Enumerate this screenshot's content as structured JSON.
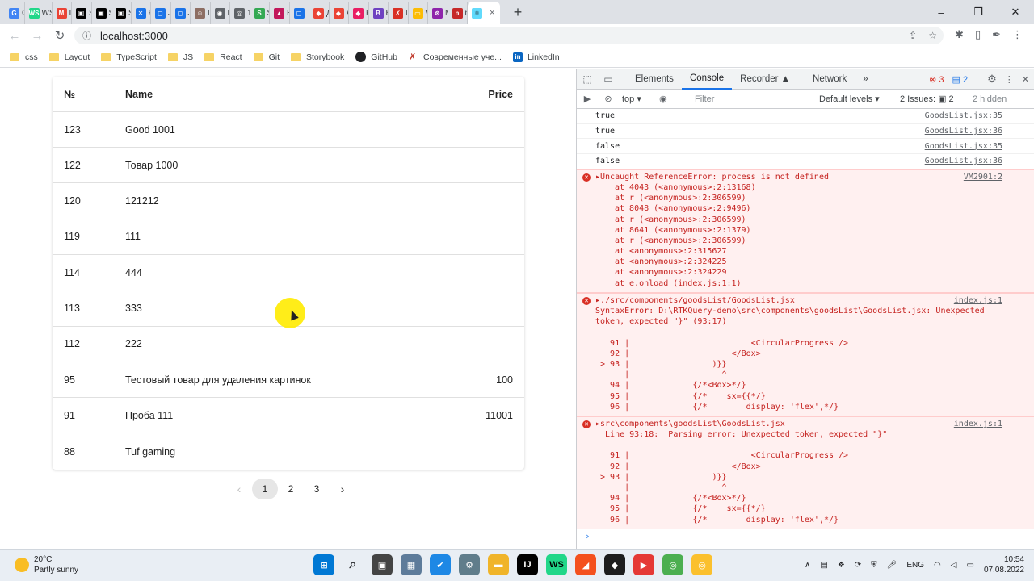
{
  "browser": {
    "tabs": [
      {
        "label": "Gc",
        "color": "#4285f4",
        "glyph": "G"
      },
      {
        "label": "WS",
        "color": "#21d789",
        "glyph": "WS"
      },
      {
        "label": "Inl",
        "color": "#ea4335",
        "glyph": "M"
      },
      {
        "label": "Sp",
        "color": "#000000",
        "glyph": "▣"
      },
      {
        "label": "Sp",
        "color": "#000000",
        "glyph": "▣"
      },
      {
        "label": "Sp",
        "color": "#000000",
        "glyph": "▣"
      },
      {
        "label": "Pa",
        "color": "#1a73e8",
        "glyph": "✕"
      },
      {
        "label": "JG",
        "color": "#1a73e8",
        "glyph": "◻"
      },
      {
        "label": "JG",
        "color": "#1a73e8",
        "glyph": "◻"
      },
      {
        "label": "Dc",
        "color": "#8d6e63",
        "glyph": "☺"
      },
      {
        "label": "Re",
        "color": "#5f6368",
        "glyph": "◉"
      },
      {
        "label": "13",
        "color": "#5f6368",
        "glyph": "◎"
      },
      {
        "label": "Sv",
        "color": "#34a853",
        "glyph": "S"
      },
      {
        "label": "Re",
        "color": "#c2185b",
        "glyph": "▲"
      },
      {
        "label": "Ty",
        "color": "#1a73e8",
        "glyph": "◻"
      },
      {
        "label": "Ди",
        "color": "#ea4335",
        "glyph": "◆"
      },
      {
        "label": "Ал",
        "color": "#ea4335",
        "glyph": "◆"
      },
      {
        "label": "Pl",
        "color": "#e91e63",
        "glyph": "◆"
      },
      {
        "label": "Br",
        "color": "#6f42c1",
        "glyph": "B"
      },
      {
        "label": "Lo",
        "color": "#d93025",
        "glyph": "✗"
      },
      {
        "label": "W",
        "color": "#fbbc04",
        "glyph": "▭"
      },
      {
        "label": "M",
        "color": "#8e24aa",
        "glyph": "⊗"
      },
      {
        "label": "np",
        "color": "#c62828",
        "glyph": "n"
      }
    ],
    "active_tab_glyph": "⚛",
    "active_tab_close": "×",
    "new_tab": "+",
    "window_controls": [
      "–",
      "❐",
      "✕"
    ],
    "address": "localhost:3000",
    "bookmarks": [
      {
        "label": "css",
        "kind": "folder"
      },
      {
        "label": "Layout",
        "kind": "folder"
      },
      {
        "label": "TypeScript",
        "kind": "folder"
      },
      {
        "label": "JS",
        "kind": "folder"
      },
      {
        "label": "React",
        "kind": "folder"
      },
      {
        "label": "Git",
        "kind": "folder"
      },
      {
        "label": "Storybook",
        "kind": "folder"
      },
      {
        "label": "GitHub",
        "kind": "github"
      },
      {
        "label": "Современные уче...",
        "kind": "site"
      },
      {
        "label": "LinkedIn",
        "kind": "linkedin"
      }
    ]
  },
  "table": {
    "headers": {
      "num": "№",
      "name": "Name",
      "price": "Price"
    },
    "rows": [
      {
        "num": "123",
        "name": "Good 1001",
        "price": ""
      },
      {
        "num": "122",
        "name": "Товар 1000",
        "price": ""
      },
      {
        "num": "120",
        "name": "121212",
        "price": ""
      },
      {
        "num": "119",
        "name": "111",
        "price": ""
      },
      {
        "num": "114",
        "name": "444",
        "price": ""
      },
      {
        "num": "113",
        "name": "333",
        "price": ""
      },
      {
        "num": "112",
        "name": "222",
        "price": ""
      },
      {
        "num": "95",
        "name": "Тестовый товар для удаления картинок",
        "price": "100"
      },
      {
        "num": "91",
        "name": "Проба 111",
        "price": "11001"
      },
      {
        "num": "88",
        "name": "Tuf gaming",
        "price": ""
      }
    ]
  },
  "pagination": {
    "prev": "‹",
    "pages": [
      "1",
      "2",
      "3"
    ],
    "current": "1",
    "next": "›"
  },
  "devtools": {
    "tabs": [
      "Elements",
      "Console",
      "Recorder ▲",
      "Network",
      "»"
    ],
    "active_tab": "Console",
    "error_count": "3",
    "message_count": "2",
    "context": "top ▾",
    "filter_placeholder": "Filter",
    "levels": "Default levels ▾",
    "issues": "2 Issues: ▣ 2",
    "hidden": "2 hidden",
    "logs": [
      {
        "text": "true",
        "src": "GoodsList.jsx:35"
      },
      {
        "text": "true",
        "src": "GoodsList.jsx:36"
      },
      {
        "text": "false",
        "src": "GoodsList.jsx:35"
      },
      {
        "text": "false",
        "src": "GoodsList.jsx:36"
      }
    ],
    "errors": [
      {
        "title": "▸Uncaught ReferenceError: process is not defined",
        "src": "VM2901:2",
        "lines": [
          "at 4043 (<anonymous>:2:13168)",
          "at r (<anonymous>:2:306599)",
          "at 8048 (<anonymous>:2:9496)",
          "at r (<anonymous>:2:306599)",
          "at 8641 (<anonymous>:2:1379)",
          "at r (<anonymous>:2:306599)",
          "at <anonymous>:2:315627",
          "at <anonymous>:2:324225",
          "at <anonymous>:2:324229",
          "at e.onload (index.js:1:1)"
        ]
      },
      {
        "title": "▸./src/components/goodsList/GoodsList.jsx",
        "src": "index.js:1",
        "lines": [
          "SyntaxError: D:\\RTKQuery-demo\\src\\components\\goodsList\\GoodsList.jsx: Unexpected",
          "token, expected \"}\" (93:17)",
          "",
          "   91 |                         <CircularProgress />",
          "   92 |                     </Box>",
          " > 93 |                 )}}",
          "      |                   ^",
          "   94 |             {/*<Box>*/}",
          "   95 |             {/*    sx={{*/}",
          "   96 |             {/*        display: 'flex',*/}"
        ]
      },
      {
        "title": "▸src\\components\\goodsList\\GoodsList.jsx",
        "src": "index.js:1",
        "lines": [
          "  Line 93:18:  Parsing error: Unexpected token, expected \"}\"",
          "",
          "   91 |                         <CircularProgress />",
          "   92 |                     </Box>",
          " > 93 |                 )}}",
          "      |                   ^",
          "   94 |             {/*<Box>*/}",
          "   95 |             {/*    sx={{*/}",
          "   96 |             {/*        display: 'flex',*/}"
        ]
      }
    ],
    "prompt": "›"
  },
  "taskbar": {
    "temperature": "20°C",
    "weather": "Partly sunny",
    "language": "ENG",
    "time": "10:54",
    "date": "07.08.2022"
  },
  "colors": {
    "accent": "#1a73e8",
    "error": "#d93025",
    "error_bg": "#fff0f0",
    "cursor_highlight": "#ffeb00"
  }
}
